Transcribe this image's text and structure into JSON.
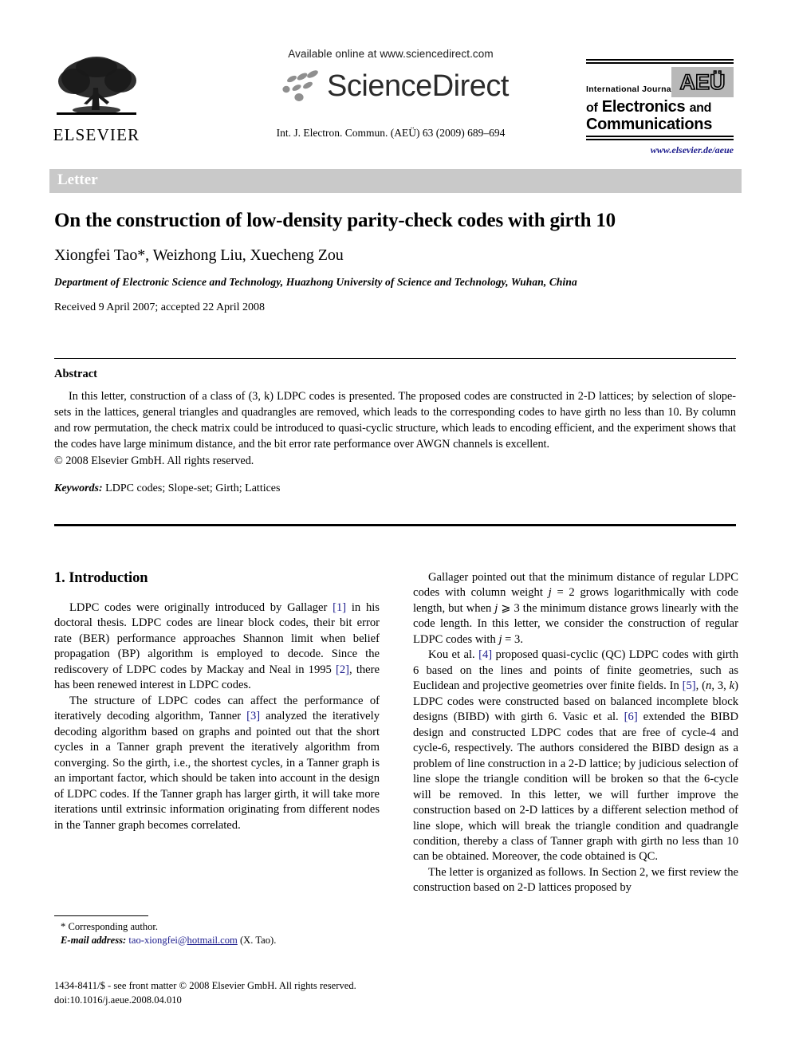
{
  "header": {
    "elsevier": {
      "wordmark": "ELSEVIER",
      "logo_name": "elsevier-tree-logo"
    },
    "sciencedirect": {
      "available_line": "Available online at www.sciencedirect.com",
      "wordmark": "ScienceDirect",
      "citation": "Int. J. Electron. Commun. (AEÜ) 63 (2009) 689–694"
    },
    "journal_logo": {
      "line1": "International Journal",
      "badge": "AEÜ",
      "line2_bold": "Electronics",
      "line2_prefix": "of",
      "line2_suffix": "and",
      "line3": "Communications",
      "url": "www.elsevier.de/aeue"
    }
  },
  "banner": {
    "label": "Letter",
    "background": "#c9c9c9",
    "text_color": "#ffffff"
  },
  "article": {
    "title": "On the construction of low-density parity-check codes with girth 10",
    "authors": "Xiongfei Tao*, Weizhong Liu, Xuecheng Zou",
    "affiliation": "Department of Electronic Science and Technology, Huazhong University of Science and Technology, Wuhan, China",
    "history": "Received 9 April 2007; accepted 22 April 2008"
  },
  "abstract": {
    "heading": "Abstract",
    "body": "In this letter, construction of a class of (3, k) LDPC codes is presented. The proposed codes are constructed in 2-D lattices; by selection of slope-sets in the lattices, general triangles and quadrangles are removed, which leads to the corresponding codes to have girth no less than 10. By column and row permutation, the check matrix could be introduced to quasi-cyclic structure, which leads to encoding efficient, and the experiment shows that the codes have large minimum distance, and the bit error rate performance over AWGN channels is excellent.",
    "copyright": "© 2008 Elsevier GmbH. All rights reserved.",
    "keywords_label": "Keywords:",
    "keywords_value": "LDPC codes; Slope-set; Girth; Lattices"
  },
  "body": {
    "section_heading": "1. Introduction",
    "left_paragraphs": [
      {
        "parts": [
          {
            "t": "LDPC codes were originally introduced by Gallager "
          },
          {
            "t": "[1]",
            "s": "ref"
          },
          {
            "t": " in his doctoral thesis. LDPC codes are linear block codes, their bit error rate (BER) performance approaches Shannon limit when belief propagation (BP) algorithm is employed to decode. Since the rediscovery of LDPC codes by Mackay and Neal in 1995 "
          },
          {
            "t": "[2]",
            "s": "ref"
          },
          {
            "t": ", there has been renewed interest in LDPC codes."
          }
        ]
      },
      {
        "parts": [
          {
            "t": "The structure of LDPC codes can affect the performance of iteratively decoding algorithm, Tanner "
          },
          {
            "t": "[3]",
            "s": "ref"
          },
          {
            "t": " analyzed the iteratively decoding algorithm based on graphs and pointed out that the short cycles in a Tanner graph prevent the iteratively algorithm from converging. So the girth, i.e., the shortest cycles, in a Tanner graph is an important factor, which should be taken into account in the design of LDPC codes. If the Tanner graph has larger girth, it will take more iterations until extrinsic information originating from different nodes in the Tanner graph becomes correlated."
          }
        ]
      }
    ],
    "right_paragraphs": [
      {
        "parts": [
          {
            "t": "Gallager pointed out that the minimum distance of regular LDPC codes with column weight "
          },
          {
            "t": "j",
            "s": "mi"
          },
          {
            "t": " = 2 grows logarithmically with code length, but when "
          },
          {
            "t": "j",
            "s": "mi"
          },
          {
            "t": " ⩾ 3 the minimum distance grows linearly with the code length. In this letter, we consider the construction of regular LDPC codes with "
          },
          {
            "t": "j",
            "s": "mi"
          },
          {
            "t": " = 3."
          }
        ]
      },
      {
        "parts": [
          {
            "t": "Kou et al. "
          },
          {
            "t": "[4]",
            "s": "ref"
          },
          {
            "t": " proposed quasi-cyclic (QC) LDPC codes with girth 6 based on the lines and points of finite geometries, such as Euclidean and projective geometries over finite fields. In "
          },
          {
            "t": "[5]",
            "s": "ref"
          },
          {
            "t": ", ("
          },
          {
            "t": "n",
            "s": "mi"
          },
          {
            "t": ", 3, "
          },
          {
            "t": "k",
            "s": "mi"
          },
          {
            "t": ") LDPC codes were constructed based on balanced incomplete block designs (BIBD) with girth 6. Vasic et al. "
          },
          {
            "t": "[6]",
            "s": "ref"
          },
          {
            "t": " extended the BIBD design and constructed LDPC codes that are free of cycle-4 and cycle-6, respectively. The authors considered the BIBD design as a problem of line construction in a 2-D lattice; by judicious selection of line slope the triangle condition will be broken so that the 6-cycle will be removed. In this letter, we will further improve the construction based on 2-D lattices by a different selection method of line slope, which will break the triangle condition and quadrangle condition, thereby a class of Tanner graph with girth no less than 10 can be obtained. Moreover, the code obtained is QC."
          }
        ]
      },
      {
        "parts": [
          {
            "t": "The letter is organized as follows. In Section 2, we first review the construction based on 2-D lattices proposed by"
          }
        ]
      }
    ]
  },
  "footnote": {
    "corresponding": "* Corresponding author.",
    "email_label": "E-mail address:",
    "email_prefix": "tao-xiongfei@",
    "email_domain": "hotmail.com",
    "email_suffix": " (X. Tao)."
  },
  "imprint": {
    "line1": "1434-8411/$ - see front matter © 2008 Elsevier GmbH. All rights reserved.",
    "line2": "doi:10.1016/j.aeue.2008.04.010"
  },
  "colors": {
    "link": "#1a1a8c",
    "banner_gray": "#c9c9c9",
    "badge_gray": "#b8b8b8"
  }
}
